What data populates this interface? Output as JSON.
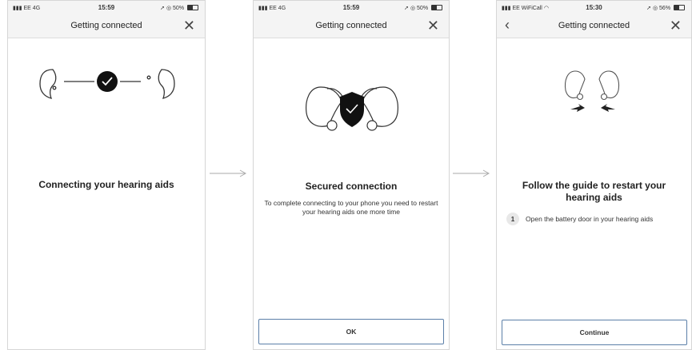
{
  "screens": [
    {
      "status": {
        "carrier": "EE 4G",
        "time": "15:59",
        "right": "50%"
      },
      "nav": {
        "title": "Getting connected"
      },
      "heading": "Connecting your hearing aids"
    },
    {
      "status": {
        "carrier": "EE 4G",
        "time": "15:59",
        "right": "50%"
      },
      "nav": {
        "title": "Getting connected"
      },
      "heading": "Secured connection",
      "body": "To complete connecting to your phone you need to restart your hearing aids one more time",
      "button": "OK"
    },
    {
      "status": {
        "carrier": "EE WiFiCall",
        "time": "15:30",
        "right": "56%"
      },
      "nav": {
        "title": "Getting connected"
      },
      "heading": "Follow the guide to restart your hearing aids",
      "step": {
        "number": "1",
        "text": "Open the battery door in your hearing aids"
      },
      "button": "Continue"
    }
  ],
  "icons": {
    "close": "close-icon",
    "back": "chevron-left-icon",
    "flow_arrow": "arrow-right-icon"
  },
  "colors": {
    "button_border": "#5b7fa8",
    "nav_background": "#f4f4f4",
    "checkmark_badge": "#111111"
  }
}
